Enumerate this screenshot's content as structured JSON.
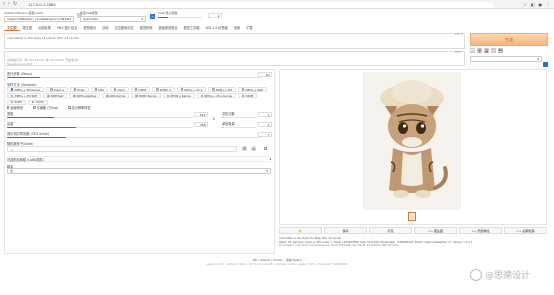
{
  "browser": {
    "url": "127.0.0.1:7860",
    "nav_icons": [
      "back-icon",
      "forward-icon",
      "reload-icon"
    ]
  },
  "header": {
    "model_label": "Stable Diffusion 模型(ckpt)",
    "model_value": "majicmixRealistic_v7.safetensors [7c819b6d13]",
    "vae_label": "外挂VAE模型",
    "vae_value": "Automatic",
    "clip_label": "CLIP 终止层数",
    "clip_value": "2"
  },
  "tabs": [
    "文生图",
    "图生图",
    "后期处理",
    "PNG 图片信息",
    "模型融合",
    "训练",
    "无边图像浏览",
    "模型转换",
    "超级模型融合",
    "模型工具箱",
    "WD 1.4 标签器",
    "设置",
    "扩展"
  ],
  "prompt": {
    "positive": "cute kitten in the style of a Pixar film, 3d render",
    "negative_placeholder": "反向提示词（按 Ctrl+Enter 或 Alt+Enter 开始生成）\nNegative prompt"
  },
  "generate": {
    "label": "生成",
    "counter_positive": "13/75",
    "counter_negative": "0/75"
  },
  "params": {
    "sampler_label": "迭代步数 (Steps)",
    "steps": "20",
    "sampler_method_label": "采样方法 (Sampler)",
    "samplers": [
      "DPM++ 2M Karras",
      "Euler a",
      "Euler",
      "LMS",
      "Heun",
      "DPM2",
      "DPM2 a",
      "DPM++ 2S a",
      "DPM++ 2M",
      "DPM++ SDE",
      "DPM++ 2M SDE",
      "DPM fast",
      "DPM adaptive",
      "LMS Karras",
      "DPM2 Karras",
      "DPM2 a Karras",
      "DPM++ 2S a Karras",
      "DDIM",
      "PLMS",
      "UniPC"
    ],
    "selected_sampler_index": 0,
    "checkbox_face": "面部修复",
    "checkbox_tiling": "平铺图 (Tiling)",
    "checkbox_hires": "高分辨率修复",
    "width_label": "宽度",
    "width": "512",
    "height_label": "高度",
    "height": "768",
    "batch_count_label": "总批次数",
    "batch_count": "1",
    "batch_size_label": "单批数量",
    "batch_size": "1",
    "cfg_label": "提示词引导系数 (CFG Scale)",
    "cfg": "7",
    "seed_label": "随机数种子(Seed)",
    "seed": "-1",
    "extra_label": "可选附加网络 (LoRA插件)",
    "script_label": "脚本",
    "script_value": "无",
    "levels": {
      "steps": 0.13,
      "width": 0.25,
      "height": 0.37,
      "batch_count": 0.01,
      "batch_size": 0.01,
      "cfg": 0.23
    }
  },
  "output": {
    "buttons": [
      "📂",
      "保存",
      "打包",
      ">> 图生图",
      ">> 局部重绘",
      ">> 后期处理"
    ],
    "info_line1": "cute kitten in the style of a Pixar film, 3d render",
    "info_line2": "Steps: 20, Sampler: Euler a, CFG scale: 7, Seed: 1234567890, Size: 512x768, Model hash: 7c819b6d13, Model: majicmixRealistic_v7, Version: v1.5.1",
    "info_line3": "Time taken: 5.3s  Torch active/reserved: 3021/3594 MiB, Sys VRAM: 5123/8192 MiB (62.54%)"
  },
  "footer": {
    "links": "API • Github • Gradio • 重启 WebUI",
    "versions": "version: v1.5.1  •  python: 3.10.11  •  torch: 2.0.1+cu118  •  xformers: 0.0.20  •  gradio: 3.32.0  •  checkpoint: 7c819b6d13"
  },
  "watermark": "@思德设计",
  "colors": {
    "accent": "#2a6fd6",
    "generate_bg": "#fbb27a",
    "generate_text": "#c45a10",
    "tab_active": "#e07b2b"
  }
}
